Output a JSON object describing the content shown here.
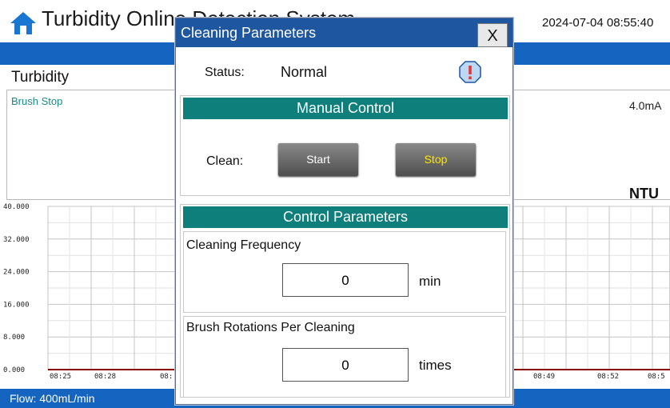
{
  "header": {
    "title": "Turbidity Online Detection System",
    "datetime": "2024-07-04 08:55:40"
  },
  "main": {
    "section_title": "Turbidity",
    "brush_status": "Brush Stop",
    "current_output": "4.0mA",
    "unit": "NTU"
  },
  "chart_data": {
    "type": "line",
    "y_ticks": [
      "40.000",
      "32.000",
      "24.000",
      "16.000",
      "8.000",
      "0.000"
    ],
    "x_ticks_left": [
      "08:25",
      "08:28",
      "08:"
    ],
    "x_ticks_right": [
      "08:49",
      "08:52",
      "08:5"
    ],
    "ylim": [
      0,
      40
    ],
    "series": [
      {
        "values": [
          0,
          0,
          0,
          0,
          0,
          0,
          0,
          0,
          0,
          0
        ]
      }
    ],
    "line_color": "#8b0000"
  },
  "footer": {
    "flow": "Flow:  400mL/min"
  },
  "dialog": {
    "title": "Cleaning Parameters",
    "close_label": "X",
    "status_label": "Status:",
    "status_value": "Normal",
    "manual_control": {
      "header": "Manual Control",
      "clean_label": "Clean:",
      "start_label": "Start",
      "stop_label": "Stop"
    },
    "control_parameters": {
      "header": "Control Parameters",
      "frequency_label": "Cleaning Frequency",
      "frequency_value": "0",
      "frequency_unit": "min",
      "rotations_label": "Brush Rotations Per Cleaning",
      "rotations_value": "0",
      "rotations_unit": "times"
    }
  },
  "colors": {
    "bar_blue": "#1565c0",
    "teal": "#0e7f7a",
    "stop_text": "#ffe600",
    "alert": "#e53935"
  },
  "icons": {
    "home": "home-icon",
    "alert": "alert-icon"
  }
}
